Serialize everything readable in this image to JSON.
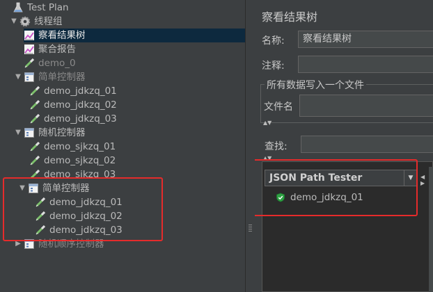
{
  "tree": {
    "nodes": [
      {
        "label": "Test Plan",
        "icon": "flask-icon",
        "expanded": true
      },
      {
        "label": "线程组",
        "icon": "gear-icon",
        "expanded": true
      },
      {
        "label": "察看结果树",
        "icon": "graph-icon",
        "selected": true
      },
      {
        "label": "聚合报告",
        "icon": "graph-icon"
      },
      {
        "label": "demo_0",
        "icon": "pipette-icon",
        "disabled": true
      },
      {
        "label": "简单控制器",
        "icon": "controller-icon",
        "expanded": true,
        "disabled": true
      },
      {
        "label": "demo_jdkzq_01",
        "icon": "pipette-icon"
      },
      {
        "label": "demo_jdkzq_02",
        "icon": "pipette-icon"
      },
      {
        "label": "demo_jdkzq_03",
        "icon": "pipette-icon"
      },
      {
        "label": "随机控制器",
        "icon": "controller-icon",
        "expanded": true
      },
      {
        "label": "demo_sjkzq_01",
        "icon": "pipette-icon"
      },
      {
        "label": "demo_sjkzq_02",
        "icon": "pipette-icon"
      },
      {
        "label": "demo_sjkzq_03",
        "icon": "pipette-icon"
      },
      {
        "label": "简单控制器",
        "icon": "controller-icon",
        "expanded": true
      },
      {
        "label": "demo_jdkzq_01",
        "icon": "pipette-icon"
      },
      {
        "label": "demo_jdkzq_02",
        "icon": "pipette-icon"
      },
      {
        "label": "demo_jdkzq_03",
        "icon": "pipette-icon"
      },
      {
        "label": "随机顺序控制器",
        "icon": "controller-icon",
        "expanded": false,
        "disabled": true
      }
    ]
  },
  "panel": {
    "title": "察看结果树",
    "name_label": "名称:",
    "name_value": "察看结果树",
    "comment_label": "注释:",
    "comment_value": "",
    "file_group_title": "所有数据写入一个文件",
    "file_label": "文件名",
    "file_value": "",
    "search_label": "查找:",
    "search_value": "",
    "renderer": "JSON Path Tester",
    "results": [
      {
        "label": "demo_jdkzq_01",
        "status": "success",
        "icon": "shield-check-icon"
      }
    ]
  },
  "colors": {
    "background": "#3c3f41",
    "selection": "#0d293e",
    "annotation": "#e52b2b",
    "success": "#2ea043"
  }
}
